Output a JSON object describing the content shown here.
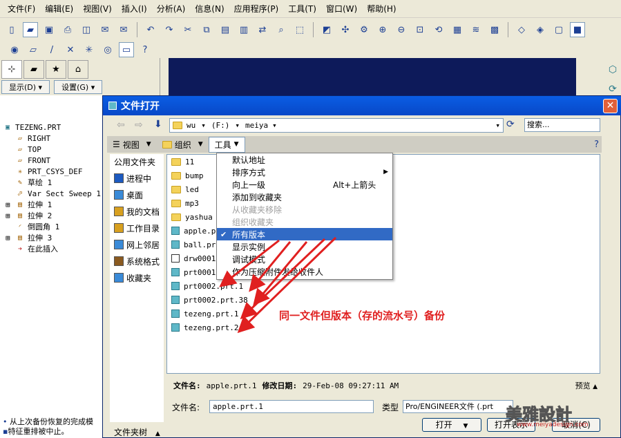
{
  "menubar": [
    "文件(F)",
    "编辑(E)",
    "视图(V)",
    "插入(I)",
    "分析(A)",
    "信息(N)",
    "应用程序(P)",
    "工具(T)",
    "窗口(W)",
    "帮助(H)"
  ],
  "nav": {
    "display_btn": "显示(D)",
    "settings_btn": "设置(G)",
    "tree": [
      {
        "label": "TEZENG.PRT",
        "expander": ""
      },
      {
        "label": "RIGHT",
        "expander": ""
      },
      {
        "label": "TOP",
        "expander": ""
      },
      {
        "label": "FRONT",
        "expander": ""
      },
      {
        "label": "PRT_CSYS_DEF",
        "expander": ""
      },
      {
        "label": "草绘 1",
        "expander": ""
      },
      {
        "label": "Var Sect Sweep 1",
        "expander": ""
      },
      {
        "label": "拉伸 1",
        "expander": "⊞"
      },
      {
        "label": "拉伸 2",
        "expander": "⊞"
      },
      {
        "label": "倒圆角 1",
        "expander": ""
      },
      {
        "label": "拉伸 3",
        "expander": "⊞"
      },
      {
        "label": "在此插入",
        "expander": ""
      }
    ]
  },
  "status": {
    "line1": "从上次备份恢复的完成模",
    "line2": "特征重排被中止。"
  },
  "dialog": {
    "title": "文件打开",
    "address": {
      "crumb1": "wu",
      "crumb2": "(F:)",
      "crumb3": "meiya"
    },
    "search_placeholder": "搜索...",
    "cmd": {
      "view": "视图",
      "organize": "组织",
      "tools": "工具"
    },
    "sidebar": {
      "title": "公用文件夹",
      "items": [
        "进程中",
        "桌面",
        "我的文档",
        "工作目录",
        "网上邻居",
        "系统格式",
        "收藏夹"
      ],
      "folder_tree": "文件夹树"
    },
    "files": [
      {
        "name": "11",
        "kind": "folder"
      },
      {
        "name": "bump",
        "kind": "folder"
      },
      {
        "name": "led",
        "kind": "folder"
      },
      {
        "name": "mp3",
        "kind": "folder"
      },
      {
        "name": "yashua",
        "kind": "folder"
      },
      {
        "name": "apple.p",
        "kind": "part"
      },
      {
        "name": "ball.pr",
        "kind": "part"
      },
      {
        "name": "drw0001",
        "kind": "drw"
      },
      {
        "name": "prt0001",
        "kind": "part"
      },
      {
        "name": "prt0002.prt.1",
        "kind": "part"
      },
      {
        "name": "prt0002.prt.38",
        "kind": "part"
      },
      {
        "name": "tezeng.prt.1",
        "kind": "part"
      },
      {
        "name": "tezeng.prt.2",
        "kind": "part"
      }
    ],
    "menu": [
      {
        "label": "默认地址",
        "state": "normal",
        "shortcut": "",
        "submenu": false
      },
      {
        "label": "排序方式",
        "state": "normal",
        "shortcut": "",
        "submenu": true
      },
      {
        "label": "向上一级",
        "state": "normal",
        "shortcut": "Alt+上箭头",
        "submenu": false
      },
      {
        "label": "添加到收藏夹",
        "state": "normal",
        "shortcut": "",
        "submenu": false
      },
      {
        "label": "从收藏夹移除",
        "state": "disabled",
        "shortcut": "",
        "submenu": false
      },
      {
        "label": "组织收藏夹",
        "state": "disabled",
        "shortcut": "",
        "submenu": false
      },
      {
        "label": "所有版本",
        "state": "selected",
        "shortcut": "",
        "submenu": false
      },
      {
        "label": "显示实例",
        "state": "normal",
        "shortcut": "",
        "submenu": false
      },
      {
        "label": "调试模式",
        "state": "normal",
        "shortcut": "",
        "submenu": false
      },
      {
        "label": "作为压缩附件发给收件人",
        "state": "normal",
        "shortcut": "",
        "submenu": false
      }
    ],
    "info": {
      "name_label": "文件名:",
      "name_value": "apple.prt.1",
      "date_label": "修改日期:",
      "date_value": "29-Feb-08 09:27:11 AM",
      "preview": "预览"
    },
    "filename_label": "文件名:",
    "filename_value": "apple.prt.1",
    "type_label": "类型",
    "type_value": "Pro/ENGINEER文件 (.prt",
    "open_btn": "打开",
    "open_rep_btn": "打开表示",
    "cancel_btn": "取消(C)"
  },
  "annotation": "同一文件但版本（存的流水号）备份",
  "watermark": {
    "brand": "美雅設計",
    "url": "www.meiyadesign.com"
  },
  "colors": {
    "graphics_bg": "#0d1a5a",
    "title_bar": "#0a5de4",
    "menu_highlight": "#316ac5",
    "annotation": "#e02020"
  }
}
